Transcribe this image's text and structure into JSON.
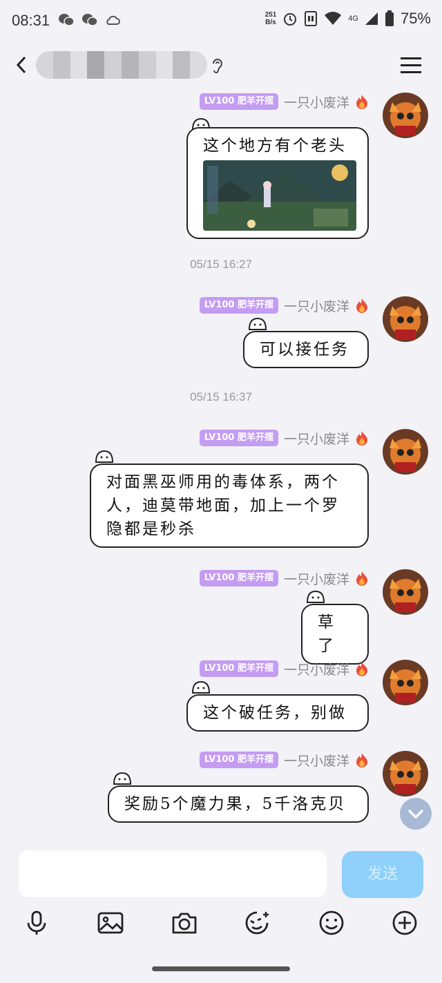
{
  "status_bar": {
    "time": "08:31",
    "net_speed_value": "251",
    "net_speed_unit": "B/s",
    "network": "4G",
    "battery": "75%"
  },
  "header": {
    "back_icon": "chevron-left-icon",
    "ear_icon": "ear-icon",
    "menu_icon": "hamburger-icon"
  },
  "sender": {
    "badge": "LV100 肥羊开摆",
    "name": "一只小废洋"
  },
  "messages": [
    {
      "text": "这个地方有个老头",
      "has_image": true
    },
    {
      "text": "可以接任务"
    },
    {
      "text": "对面黑巫师用的毒体系，两个人，迪莫带地面，加上一个罗隐都是秒杀"
    },
    {
      "text": "草了"
    },
    {
      "text": "这个破任务，别做"
    },
    {
      "text": "奖励5个魔力果，5千洛克贝"
    }
  ],
  "timestamps": [
    "05/15 16:27",
    "05/15 16:37"
  ],
  "input": {
    "placeholder": "",
    "send_label": "发送"
  },
  "toolbar": [
    "microphone-icon",
    "image-icon",
    "camera-icon",
    "sticker-icon",
    "emoji-icon",
    "plus-icon"
  ],
  "colors": {
    "badge": "#c49cf2",
    "send": "#8fd0fb",
    "background": "#f2f2f7"
  }
}
